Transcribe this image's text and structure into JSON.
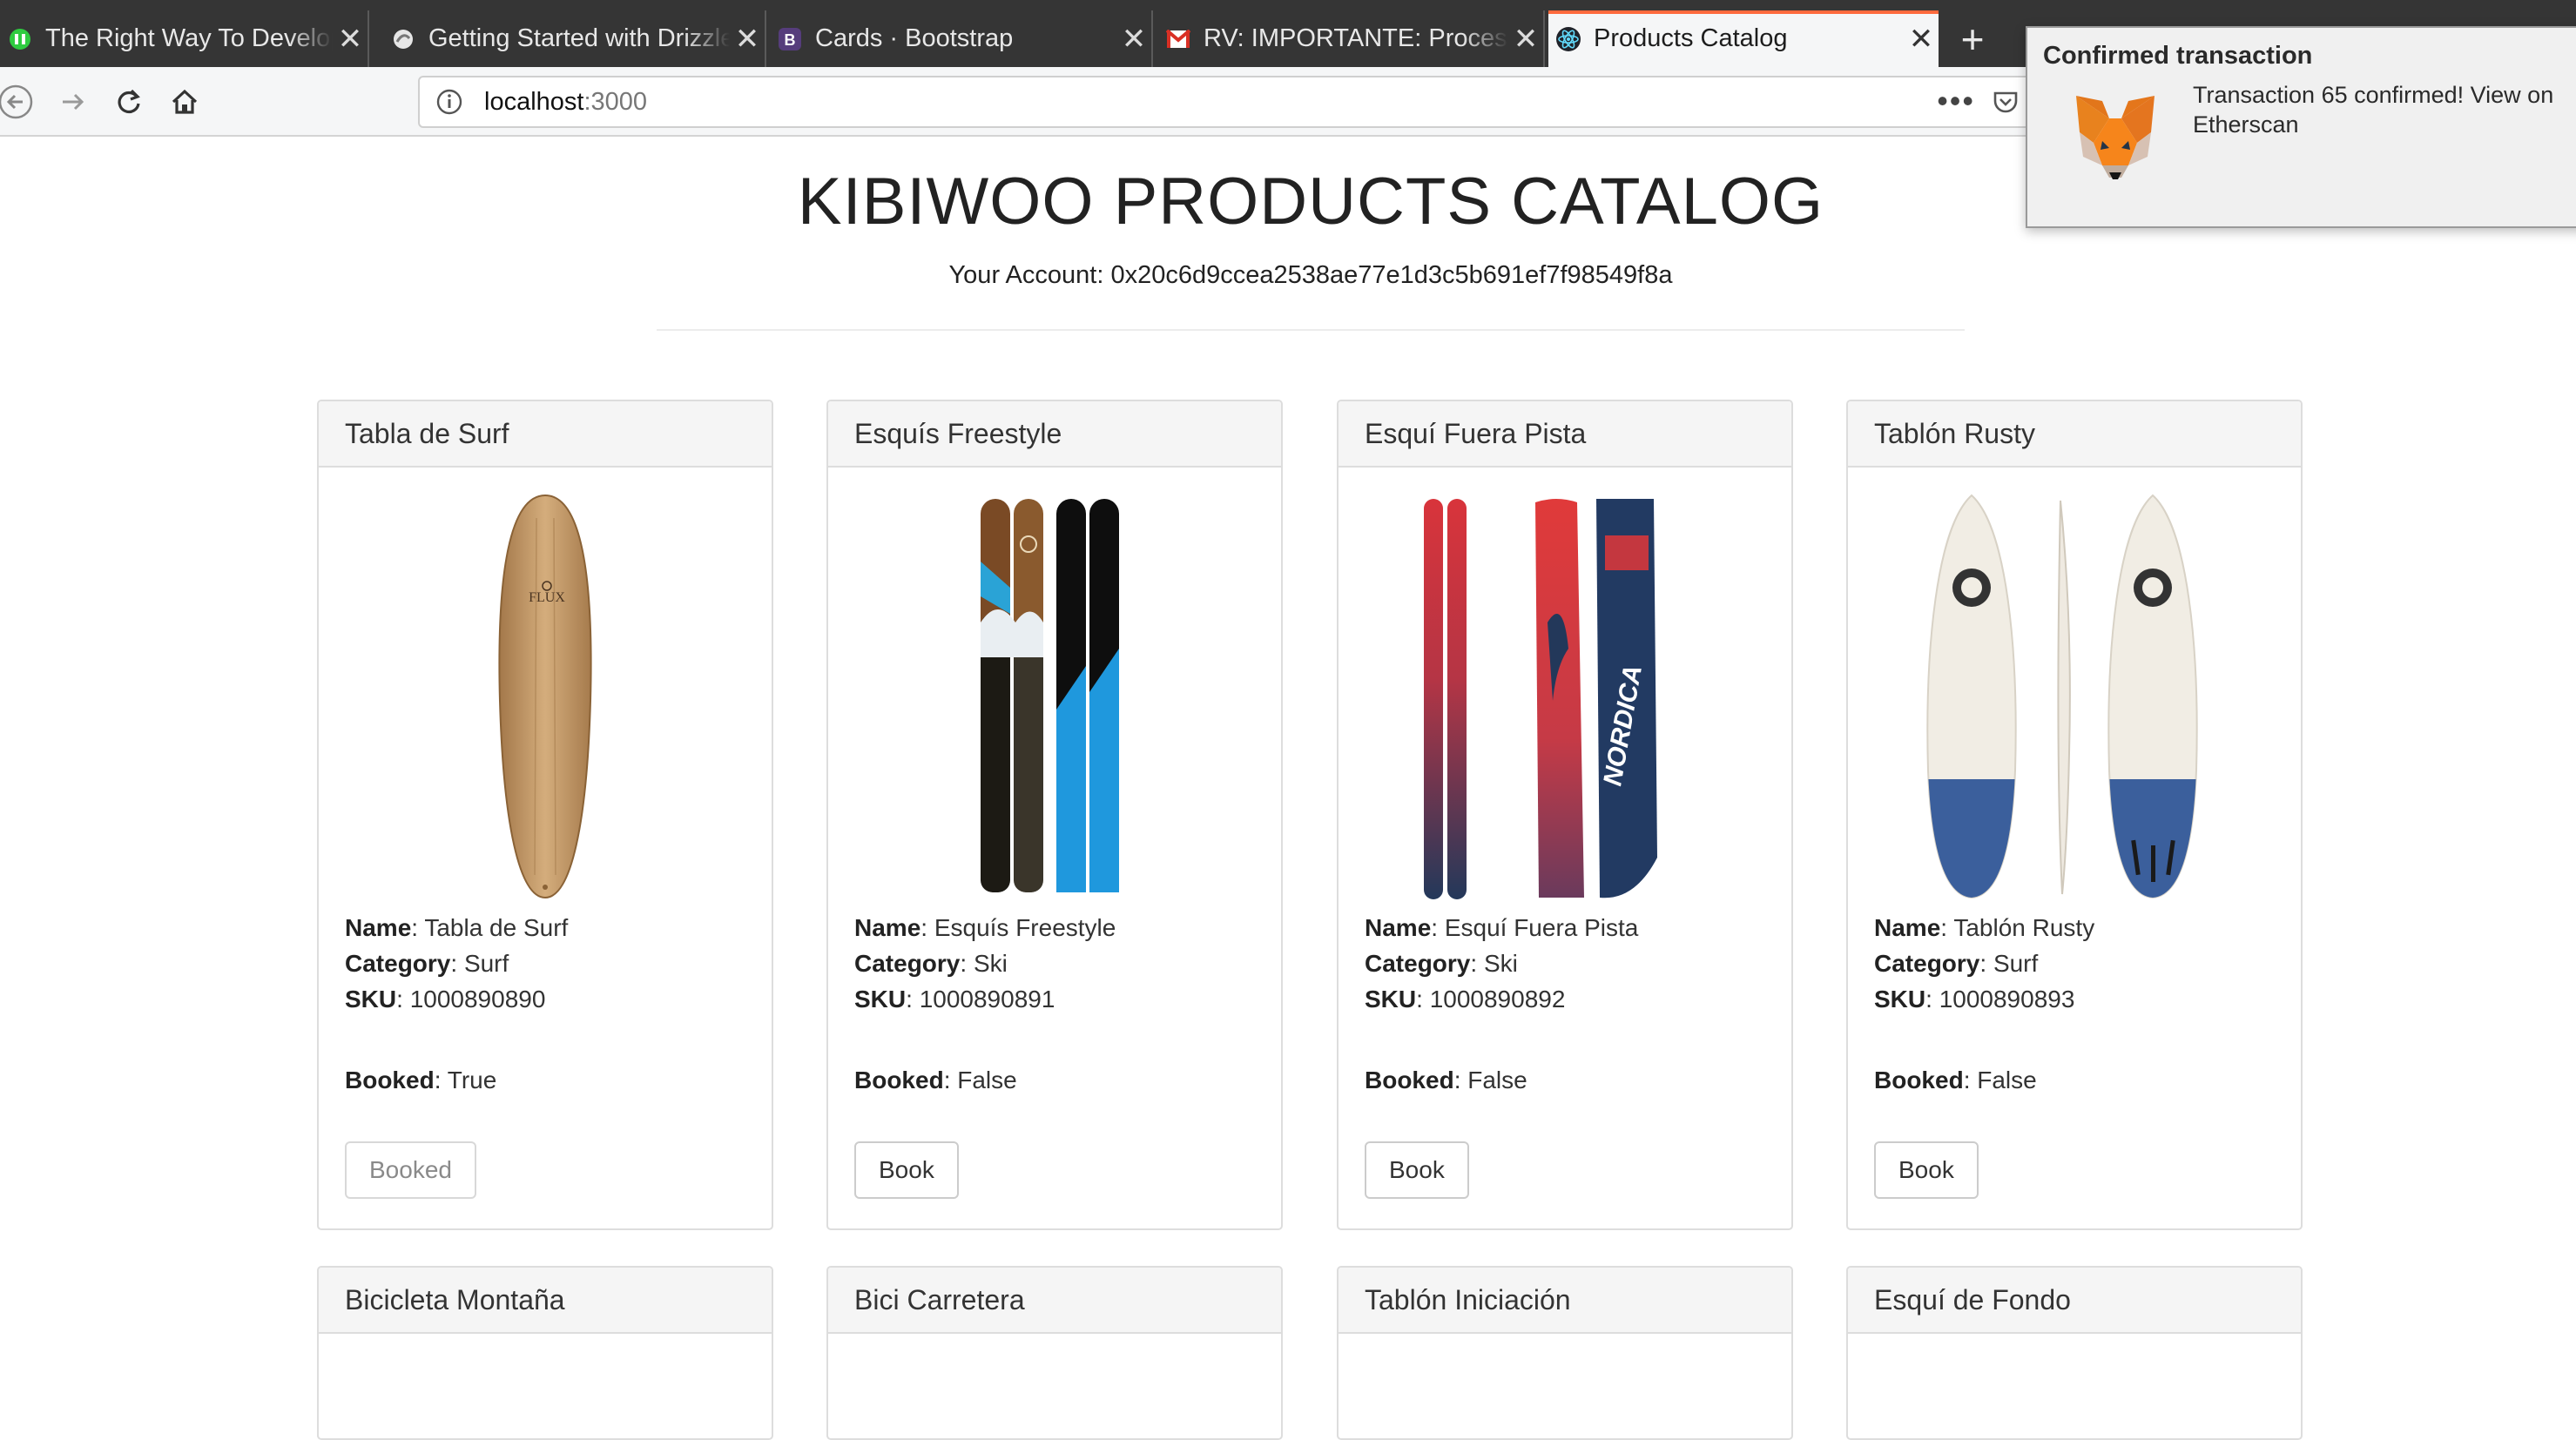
{
  "browser": {
    "tabs": [
      {
        "title": "The Right Way To Develop",
        "icon": "site-icon"
      },
      {
        "title": "Getting Started with Drizzle",
        "icon": "drizzle-icon"
      },
      {
        "title": "Cards · Bootstrap",
        "icon": "bootstrap-icon"
      },
      {
        "title": "RV: IMPORTANTE: Proceso",
        "icon": "gmail-icon"
      },
      {
        "title": "Products Catalog",
        "icon": "react-icon",
        "active": true
      }
    ],
    "new_tab": "+",
    "url_host": "localhost",
    "url_port": ":3000"
  },
  "notification": {
    "title": "Confirmed transaction",
    "body": "Transaction 65 confirmed! View on Etherscan",
    "icon": "metamask-fox-icon"
  },
  "page": {
    "title": "KIBIWOO PRODUCTS CATALOG",
    "account_label": "Your Account: ",
    "account": "0x20c6d9ccea2538ae77e1d3c5b691ef7f98549f8a"
  },
  "labels": {
    "name": "Name",
    "category": "Category",
    "sku": "SKU",
    "booked": "Booked"
  },
  "products": [
    {
      "header": "Tabla de Surf",
      "name": "Tabla de Surf",
      "category": "Surf",
      "sku": "1000890890",
      "booked": "True",
      "button": "Booked",
      "image": "surfboard-wood"
    },
    {
      "header": "Esquís Freestyle",
      "name": "Esquís Freestyle",
      "category": "Ski",
      "sku": "1000890891",
      "booked": "False",
      "button": "Book",
      "image": "skis-freestyle"
    },
    {
      "header": "Esquí Fuera Pista",
      "name": "Esquí Fuera Pista",
      "category": "Ski",
      "sku": "1000890892",
      "booked": "False",
      "button": "Book",
      "image": "skis-nordica"
    },
    {
      "header": "Tablón Rusty",
      "name": "Tablón Rusty",
      "category": "Surf",
      "sku": "1000890893",
      "booked": "False",
      "button": "Book",
      "image": "surfboard-rusty"
    },
    {
      "header": "Bicicleta Montaña"
    },
    {
      "header": "Bici Carretera"
    },
    {
      "header": "Tablón Iniciación"
    },
    {
      "header": "Esquí de Fondo"
    }
  ]
}
